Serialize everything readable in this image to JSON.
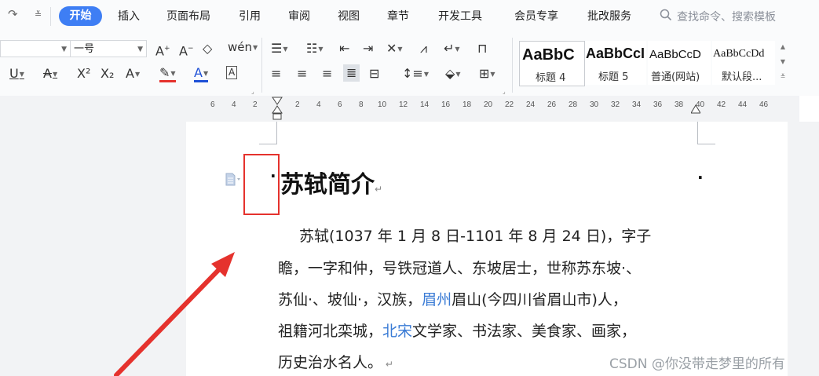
{
  "menubar": {
    "redo_icon": "redo-icon",
    "customize_icon": "customize-arrow-icon",
    "tabs": [
      "开始",
      "插入",
      "页面布局",
      "引用",
      "审阅",
      "视图",
      "章节",
      "开发工具",
      "会员专享",
      "批改服务"
    ],
    "active_tab": "开始",
    "search_placeholder": "查找命令、搜索模板"
  },
  "ribbon": {
    "font_name": "",
    "font_size": "一号",
    "row1_buttons": [
      "A⁺",
      "A⁻",
      "◇",
      "uén"
    ],
    "row2_buttons": [
      "U",
      "A",
      "X²",
      "X₂",
      "A",
      "A",
      "A",
      "A"
    ],
    "styles": [
      {
        "sample": "AaBbC",
        "label": "标题 4"
      },
      {
        "sample": "AaBbCcI",
        "label": "标题 5"
      },
      {
        "sample": "AaBbCcD",
        "label": "普通(网站)"
      },
      {
        "sample": "AaBbCcDd",
        "label": "默认段..."
      }
    ]
  },
  "ruler": {
    "numbers": [
      "6",
      "4",
      "2",
      "2",
      "4",
      "6",
      "8",
      "10",
      "12",
      "14",
      "16",
      "18",
      "20",
      "22",
      "24",
      "26",
      "28",
      "30",
      "32",
      "34",
      "36",
      "38",
      "40",
      "42",
      "44",
      "46"
    ]
  },
  "document": {
    "title": "苏轼简介",
    "body_lines": [
      [
        {
          "t": "苏轼(1037 年 1 月 8 日-1101 年 8 月 24 日)，字子"
        }
      ],
      [
        {
          "t": "瞻，一字和仲，号铁冠道人、东坡居士，世称苏东坡·、"
        }
      ],
      [
        {
          "t": "苏仙·、坡仙·，汉族，"
        },
        {
          "t": "眉州",
          "link": true
        },
        {
          "t": "眉山(今四川省眉山市)人，"
        }
      ],
      [
        {
          "t": "祖籍河北栾城，"
        },
        {
          "t": "北宋",
          "link": true
        },
        {
          "t": "文学家、书法家、美食家、画家，"
        }
      ],
      [
        {
          "t": "历史治水名人。"
        }
      ]
    ]
  },
  "watermark": "CSDN @你没带走梦里的所有",
  "colors": {
    "accent": "#3e7ef4",
    "highlight_red": "#e5322d",
    "link_blue": "#3a7bd5"
  }
}
